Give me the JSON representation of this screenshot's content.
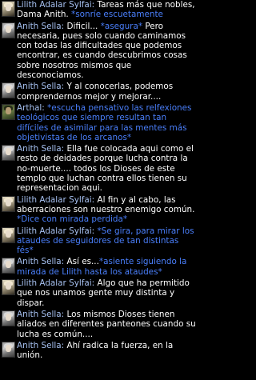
{
  "messages": [
    {
      "speaker": "Lilith Adalar Sylfai",
      "portrait": "lilith",
      "lines": [
        {
          "parts": [
            {
              "cls": "name",
              "text": "Lilith Adalar Sylfai: "
            },
            {
              "cls": "text",
              "text": "Tareas más que nobles,"
            }
          ]
        },
        {
          "parts": [
            {
              "cls": "text",
              "text": "Dama Anith. "
            },
            {
              "cls": "emote",
              "text": "*sonríe escuetamente"
            }
          ]
        }
      ]
    },
    {
      "speaker": "Anith Sella",
      "portrait": "anith",
      "lines": [
        {
          "parts": [
            {
              "cls": "name",
              "text": "Anith Sella: "
            },
            {
              "cls": "text",
              "text": "Dificil... "
            },
            {
              "cls": "emote",
              "text": "*asegura*"
            },
            {
              "cls": "text",
              "text": " Pero"
            }
          ]
        },
        {
          "parts": [
            {
              "cls": "text",
              "text": "necesaria, pues solo cuando caminamos"
            }
          ]
        },
        {
          "parts": [
            {
              "cls": "text",
              "text": "con todas las dificultades que podemos"
            }
          ]
        },
        {
          "parts": [
            {
              "cls": "text",
              "text": "encontrar, es cuando descubrimos cosas"
            }
          ]
        },
        {
          "parts": [
            {
              "cls": "text",
              "text": "sobre nosotros mismos que"
            }
          ]
        },
        {
          "parts": [
            {
              "cls": "text",
              "text": "desconociamos."
            }
          ]
        }
      ]
    },
    {
      "speaker": "Anith Sella",
      "portrait": "anith",
      "lines": [
        {
          "parts": [
            {
              "cls": "name",
              "text": "Anith Sella: "
            },
            {
              "cls": "text",
              "text": "Y al conocerlas, podemos"
            }
          ]
        },
        {
          "parts": [
            {
              "cls": "text",
              "text": "comprendernos mejor y mejorar...."
            }
          ]
        }
      ]
    },
    {
      "speaker": "Arthal",
      "portrait": "arthal",
      "lines": [
        {
          "parts": [
            {
              "cls": "name",
              "text": "Arthal: "
            },
            {
              "cls": "emote",
              "text": "*escucha pensativo las relfexiones"
            }
          ]
        },
        {
          "parts": [
            {
              "cls": "emote",
              "text": "teológicos que siempre resultan tan"
            }
          ]
        },
        {
          "parts": [
            {
              "cls": "emote",
              "text": "difíciles de asimilar para las mentes más"
            }
          ]
        },
        {
          "parts": [
            {
              "cls": "emote",
              "text": "objetivistas de los arcanos*"
            }
          ]
        }
      ]
    },
    {
      "speaker": "Anith Sella",
      "portrait": "anith",
      "lines": [
        {
          "parts": [
            {
              "cls": "name",
              "text": "Anith Sella: "
            },
            {
              "cls": "text",
              "text": "Ella fue colocada aqui como el"
            }
          ]
        },
        {
          "parts": [
            {
              "cls": "text",
              "text": "resto de deidades porque lucha contra la"
            }
          ]
        },
        {
          "parts": [
            {
              "cls": "text",
              "text": "no-muerte.... todos los Dioses de este"
            }
          ]
        },
        {
          "parts": [
            {
              "cls": "text",
              "text": "templo que luchan contra ellos tienen su"
            }
          ]
        },
        {
          "parts": [
            {
              "cls": "text",
              "text": "representacion aqui."
            }
          ]
        }
      ]
    },
    {
      "speaker": "Lilith Adalar Sylfai",
      "portrait": "lilith",
      "lines": [
        {
          "parts": [
            {
              "cls": "name",
              "text": "Lilith Adalar Sylfai: "
            },
            {
              "cls": "text",
              "text": "Al fin y al cabo, las"
            }
          ]
        },
        {
          "parts": [
            {
              "cls": "text",
              "text": "aberraciones son nuestro enemigo común."
            }
          ]
        },
        {
          "parts": [
            {
              "cls": "emote",
              "text": "*Dice con mirada perdida*"
            }
          ]
        }
      ]
    },
    {
      "speaker": "Lilith Adalar Sylfai",
      "portrait": "lilith",
      "lines": [
        {
          "parts": [
            {
              "cls": "name",
              "text": "Lilith Adalar Sylfai: "
            },
            {
              "cls": "emote",
              "text": "*Se gira, para mirar los"
            }
          ]
        },
        {
          "parts": [
            {
              "cls": "emote",
              "text": "ataudes de seguidores de tan distintas"
            }
          ]
        },
        {
          "parts": [
            {
              "cls": "emote",
              "text": "fés*"
            }
          ]
        }
      ]
    },
    {
      "speaker": "Anith Sella",
      "portrait": "anith",
      "lines": [
        {
          "parts": [
            {
              "cls": "name",
              "text": "Anith Sella: "
            },
            {
              "cls": "text",
              "text": "Así es..."
            },
            {
              "cls": "emote",
              "text": "*asiente siguiendo la"
            }
          ]
        },
        {
          "parts": [
            {
              "cls": "emote",
              "text": "mirada de Lilith hasta los ataudes*"
            }
          ]
        }
      ]
    },
    {
      "speaker": "Lilith Adalar Sylfai",
      "portrait": "lilith",
      "lines": [
        {
          "parts": [
            {
              "cls": "name",
              "text": "Lilith Adalar Sylfai: "
            },
            {
              "cls": "text",
              "text": "Algo que ha permitido"
            }
          ]
        },
        {
          "parts": [
            {
              "cls": "text",
              "text": "que nos unamos gente muy distinta y"
            }
          ]
        },
        {
          "parts": [
            {
              "cls": "text",
              "text": "dispar."
            }
          ]
        }
      ]
    },
    {
      "speaker": "Anith Sella",
      "portrait": "anith",
      "lines": [
        {
          "parts": [
            {
              "cls": "name",
              "text": "Anith Sella: "
            },
            {
              "cls": "text",
              "text": "Los mismos Dioses tienen"
            }
          ]
        },
        {
          "parts": [
            {
              "cls": "text",
              "text": "aliados en diferentes panteones cuando su"
            }
          ]
        },
        {
          "parts": [
            {
              "cls": "text",
              "text": "lucha es común...."
            }
          ]
        }
      ]
    },
    {
      "speaker": "Anith Sella",
      "portrait": "anith",
      "lines": [
        {
          "parts": [
            {
              "cls": "name",
              "text": "Anith Sella: "
            },
            {
              "cls": "text",
              "text": "Ahí radica la fuerza, en la"
            }
          ]
        },
        {
          "parts": [
            {
              "cls": "text",
              "text": "unión."
            }
          ]
        }
      ]
    }
  ]
}
